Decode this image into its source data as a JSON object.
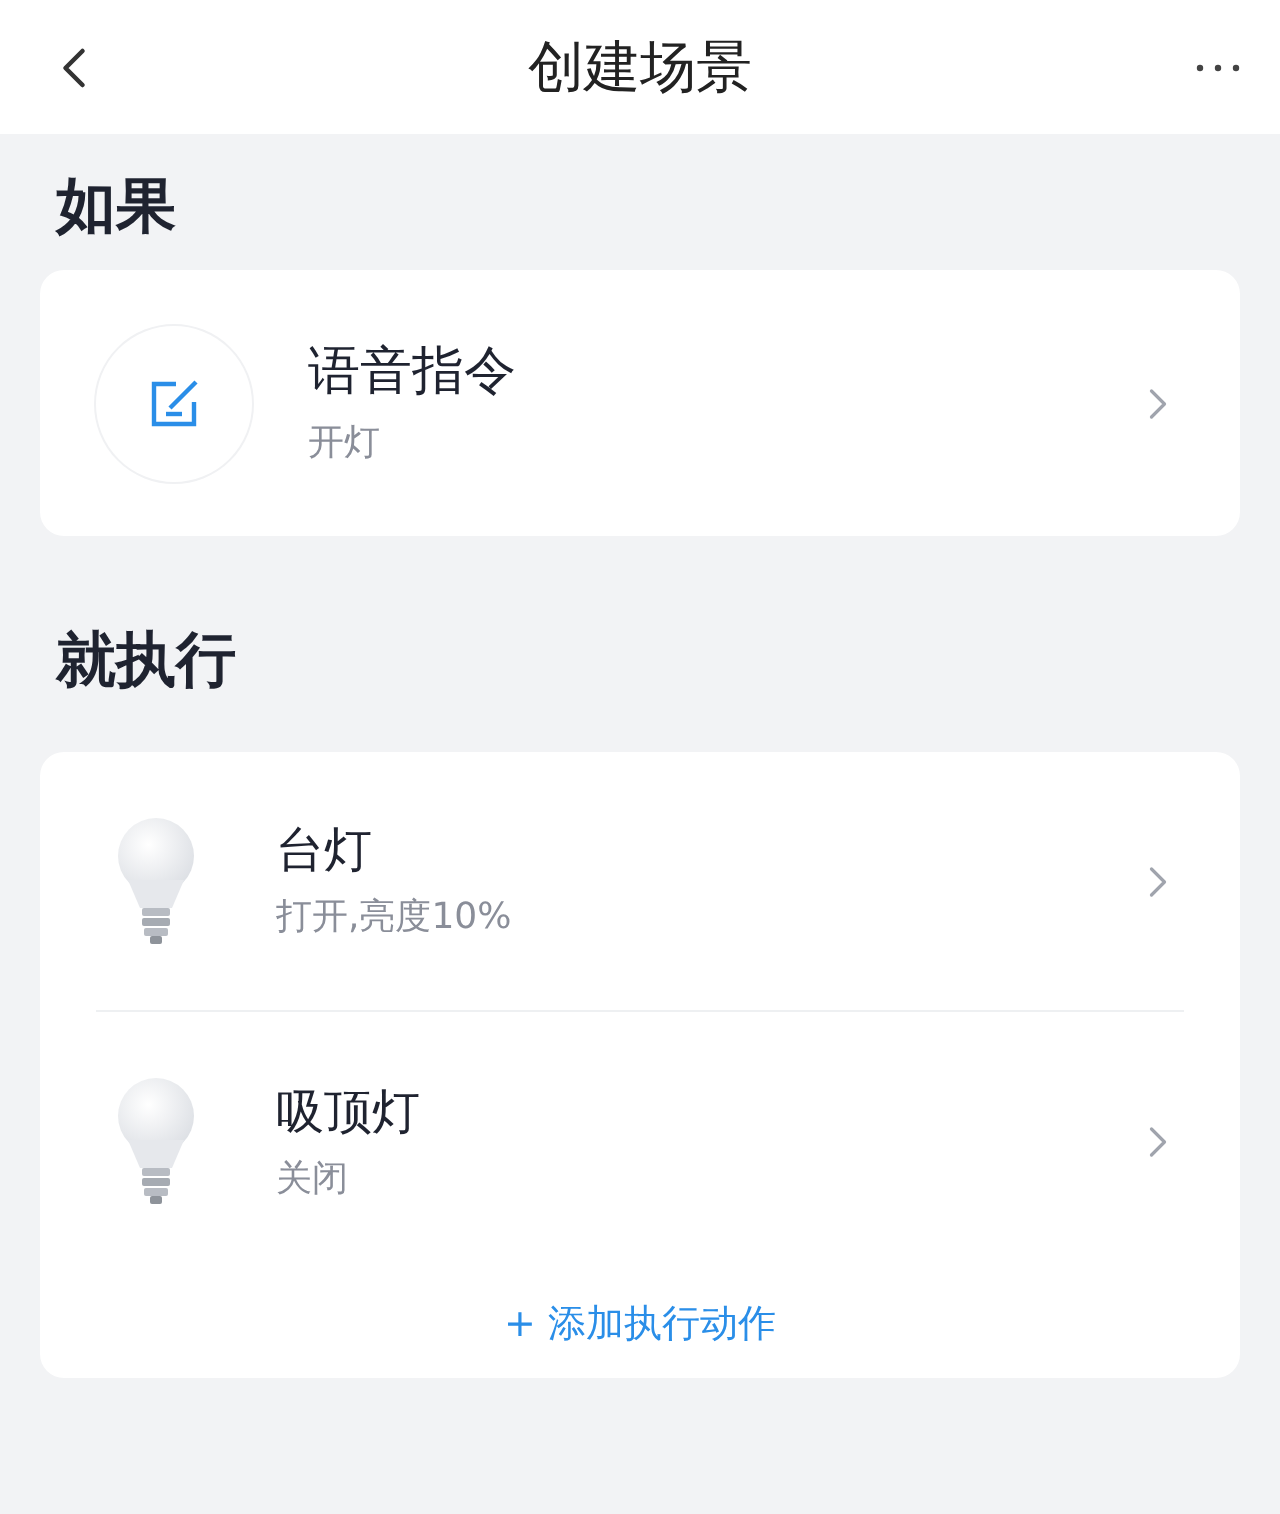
{
  "header": {
    "title": "创建场景"
  },
  "condition_section": {
    "title": "如果",
    "item": {
      "title": "语音指令",
      "subtitle": "开灯"
    }
  },
  "action_section": {
    "title": "就执行",
    "items": [
      {
        "title": "台灯",
        "subtitle": "打开,亮度10%"
      },
      {
        "title": "吸顶灯",
        "subtitle": "关闭"
      }
    ],
    "add_button": "+ 添加执行动作"
  }
}
